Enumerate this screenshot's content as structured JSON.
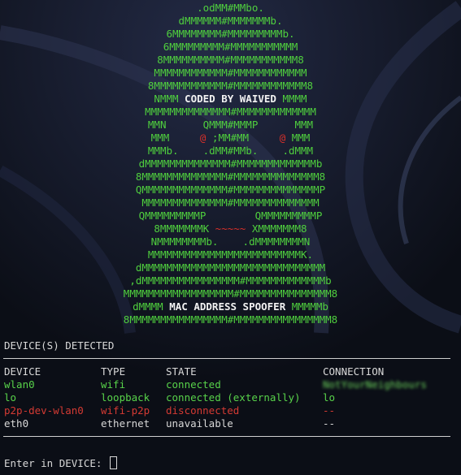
{
  "banner": {
    "lines": [
      [
        {
          "t": ".odMM#MMbo."
        }
      ],
      [
        {
          "t": "dMMMMMM#MMMMMMMb."
        }
      ],
      [
        {
          "t": "6MMMMMMMM#MMMMMMMMMb."
        }
      ],
      [
        {
          "t": "6MMMMMMMMM#MMMMMMMMMMM"
        }
      ],
      [
        {
          "t": "8MMMMMMMMMM#MMMMMMMMMMM8"
        }
      ],
      [
        {
          "t": "MMMMMMMMMMMM#MMMMMMMMMMMM"
        }
      ],
      [
        {
          "t": "8MMMMMMMMMMMM#MMMMMMMMMMMM8"
        }
      ],
      [
        {
          "t": "NMMM "
        },
        {
          "t": "CODED BY WAIVED",
          "c": "white"
        },
        {
          "t": " MMMM"
        }
      ],
      [
        {
          "t": "MMMMMMMMMMMMMM#MMMMMMMMMMMMM"
        }
      ],
      [
        {
          "t": "MMN      QMMM#MMMP      MMM"
        }
      ],
      [
        {
          "t": "MMM     "
        },
        {
          "t": "@",
          "c": "red"
        },
        {
          "t": " ;MM#MM     "
        },
        {
          "t": "@",
          "c": "red"
        },
        {
          "t": " MMM"
        }
      ],
      [
        {
          "t": "MMMb.    .dMM#MMb.    .dMMM"
        }
      ],
      [
        {
          "t": "dMMMMMMMMMMMMMM#MMMMMMMMMMMMMb"
        }
      ],
      [
        {
          "t": "8MMMMMMMMMMMMMM#MMMMMMMMMMMMMM8"
        }
      ],
      [
        {
          "t": "QMMMMMMMMMMMMMM#MMMMMMMMMMMMMMP"
        }
      ],
      [
        {
          "t": "MMMMMMMMMMMMMM#MMMMMMMMMMMMMM"
        }
      ],
      [
        {
          "t": "QMMMMMMMMMP        QMMMMMMMMMP"
        }
      ],
      [
        {
          "t": "8MMMMMMMK "
        },
        {
          "t": "~~~~~",
          "c": "red"
        },
        {
          "t": " XMMMMMMM8"
        }
      ],
      [
        {
          "t": "NMMMMMMMMb.    .dMMMMMMMMN"
        }
      ],
      [
        {
          "t": "MMMMMMMMMMMMMMMMMMMMMMMMMK."
        }
      ],
      [
        {
          "t": "dMMMMMMMMMMMMMMMMMMMMMMMMMMMMMM"
        }
      ],
      [
        {
          "t": ",dMMMMMMMMMMMMMMMM#MMMMMMMMMMMMMb"
        }
      ],
      [
        {
          "t": "MMMMMMMMMMMMMMMMMM#MMMMMMMMMMMMMMM8"
        }
      ],
      [
        {
          "t": "dMMMM "
        },
        {
          "t": "MAC ADDRESS SPOOFER",
          "c": "white"
        },
        {
          "t": " MMMMMb"
        }
      ],
      [
        {
          "t": "8MMMMMMMMMMMMMMMM#MMMMMMMMMMMMMMMM8"
        }
      ]
    ]
  },
  "devices_header": "DEVICE(S) DETECTED",
  "table": {
    "columns": [
      "DEVICE",
      "TYPE",
      "STATE",
      "CONNECTION"
    ],
    "rows": [
      {
        "device": "wlan0",
        "type": "wifi",
        "state": "connected",
        "connection": "NotYourNeighbours",
        "color": "g",
        "blur": true
      },
      {
        "device": "lo",
        "type": "loopback",
        "state": "connected (externally)",
        "connection": "lo",
        "color": "g",
        "blur": false
      },
      {
        "device": "p2p-dev-wlan0",
        "type": "wifi-p2p",
        "state": "disconnected",
        "connection": "--",
        "color": "r",
        "blur": false
      },
      {
        "device": "eth0",
        "type": "ethernet",
        "state": "unavailable",
        "connection": "--",
        "color": "w",
        "blur": false
      }
    ]
  },
  "prompt": {
    "label": "Enter in DEVICE: "
  },
  "colors": {
    "green": "#4fcf3e",
    "red": "#d9302a",
    "background": "#0c0f17",
    "text": "#d8d8d8"
  }
}
